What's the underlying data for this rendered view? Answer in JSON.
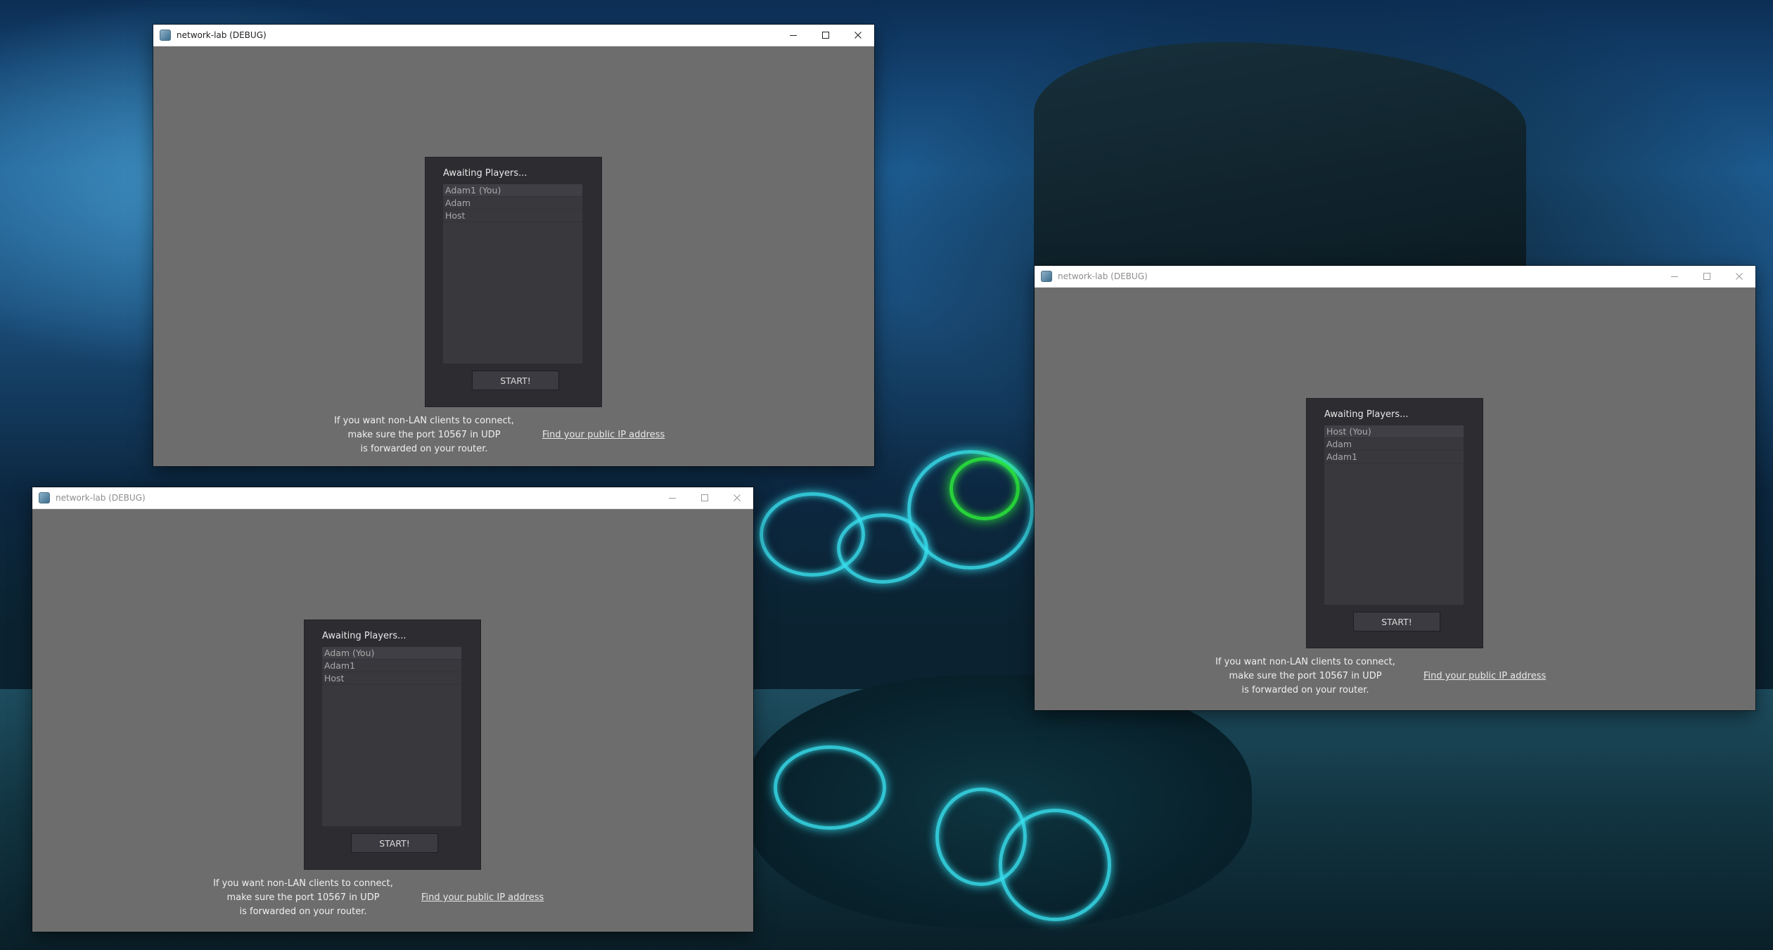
{
  "colors": {
    "window_client": "#6d6d6d",
    "lobby_panel": "#2d2c30",
    "player_list": "#39383d",
    "start_button": "#3c3b41",
    "titlebar": "#ffffff",
    "wallpaper_glow": "#39e0ef"
  },
  "icons": {
    "app": "app-icon",
    "minimize": "minimize-icon",
    "maximize": "maximize-icon",
    "close": "close-icon"
  },
  "windows": [
    {
      "title": "network-lab (DEBUG)",
      "active": true,
      "lobby": {
        "title": "Awaiting Players...",
        "players": [
          "Adam1 (You)",
          "Adam",
          "Host"
        ],
        "start_label": "START!"
      },
      "info": {
        "line1": "If you want non-LAN clients to connect,",
        "line2": "make sure the port 10567 in UDP",
        "line3": "is forwarded on your router."
      },
      "link": "Find your public IP address"
    },
    {
      "title": "network-lab (DEBUG)",
      "active": false,
      "lobby": {
        "title": "Awaiting Players...",
        "players": [
          "Host (You)",
          "Adam",
          "Adam1"
        ],
        "start_label": "START!"
      },
      "info": {
        "line1": "If you want non-LAN clients to connect,",
        "line2": "make sure the port 10567 in UDP",
        "line3": "is forwarded on your router."
      },
      "link": "Find your public IP address"
    },
    {
      "title": "network-lab (DEBUG)",
      "active": false,
      "lobby": {
        "title": "Awaiting Players...",
        "players": [
          "Adam (You)",
          "Adam1",
          "Host"
        ],
        "start_label": "START!"
      },
      "info": {
        "line1": "If you want non-LAN clients to connect,",
        "line2": "make sure the port 10567 in UDP",
        "line3": "is forwarded on your router."
      },
      "link": "Find your public IP address"
    }
  ]
}
